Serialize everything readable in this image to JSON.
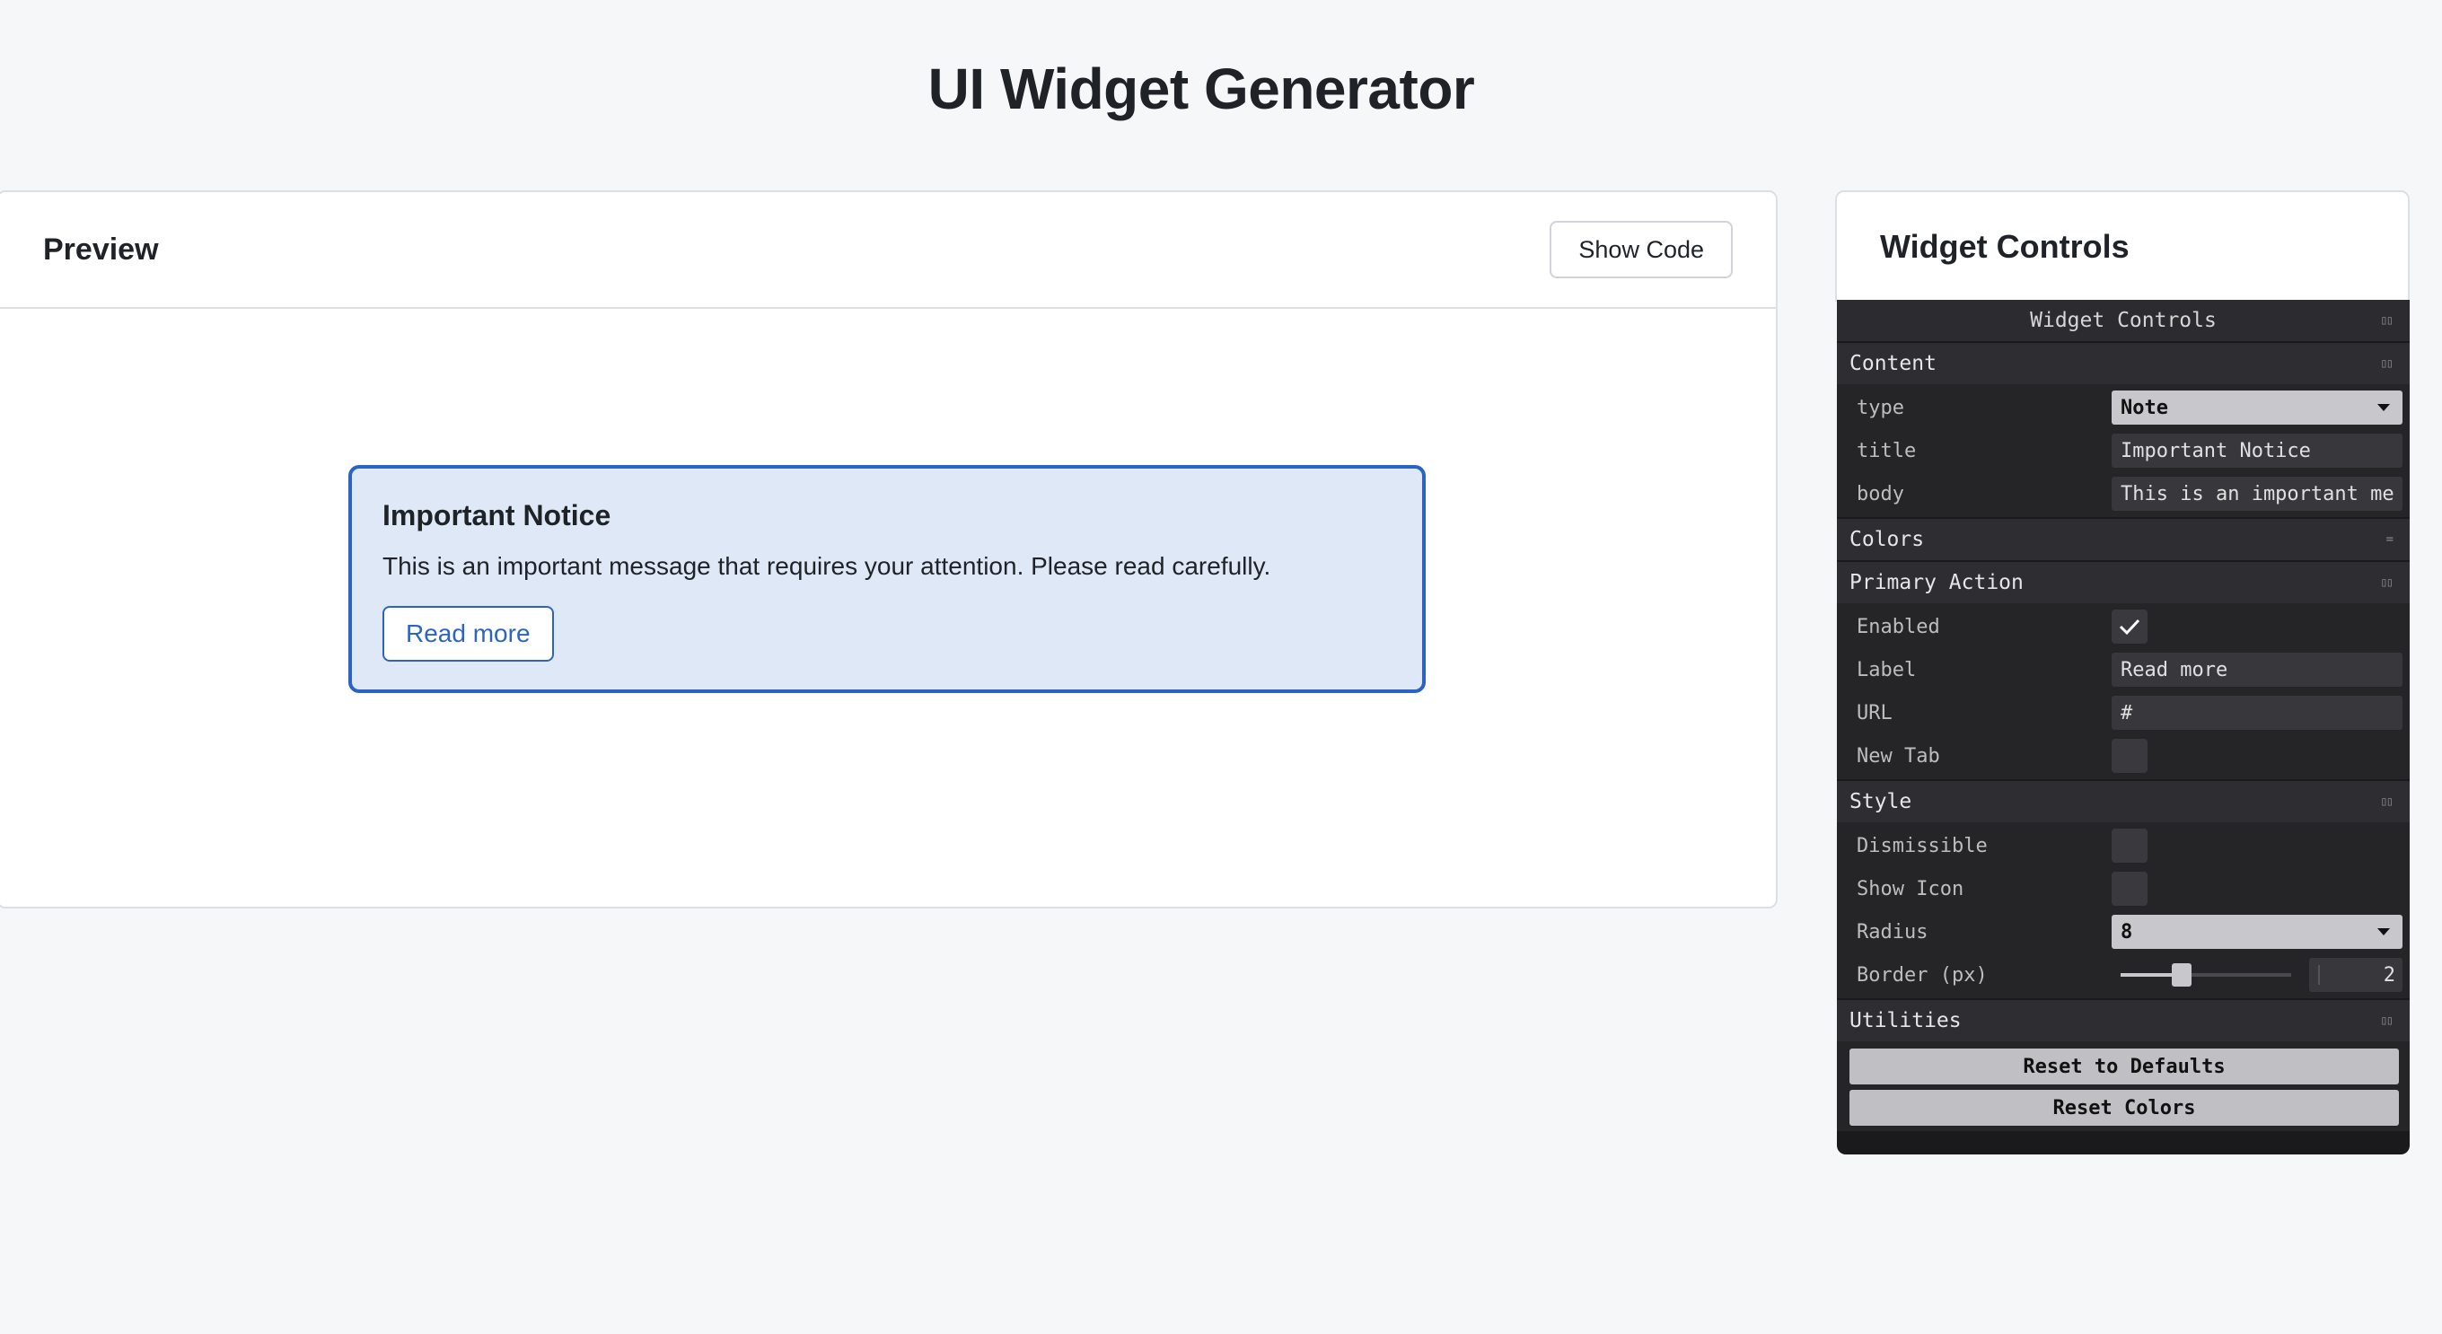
{
  "page": {
    "title": "UI Widget Generator"
  },
  "preview": {
    "heading": "Preview",
    "show_code_label": "Show Code",
    "widget": {
      "title": "Important Notice",
      "body": "This is an important message that requires your attention. Please read carefully.",
      "button_label": "Read more"
    }
  },
  "controls": {
    "card_title": "Widget Controls",
    "gui_title": "Widget Controls",
    "content": {
      "heading": "Content",
      "type_label": "type",
      "type_value": "Note",
      "title_label": "title",
      "title_value": "Important Notice",
      "body_label": "body",
      "body_value": "This is an important me"
    },
    "colors": {
      "heading": "Colors"
    },
    "primary_action": {
      "heading": "Primary Action",
      "enabled_label": "Enabled",
      "enabled": true,
      "label_label": "Label",
      "label_value": "Read more",
      "url_label": "URL",
      "url_value": "#",
      "new_tab_label": "New Tab",
      "new_tab": false
    },
    "style": {
      "heading": "Style",
      "dismissible_label": "Dismissible",
      "dismissible": false,
      "show_icon_label": "Show Icon",
      "show_icon": false,
      "radius_label": "Radius",
      "radius_value": "8",
      "border_label": "Border (px)",
      "border_value": "2",
      "border_fraction": 0.36
    },
    "utilities": {
      "heading": "Utilities",
      "reset_defaults_label": "Reset to Defaults",
      "reset_colors_label": "Reset Colors"
    }
  },
  "colors": {
    "accent": "#2c64c4",
    "notice_bg": "#dfe8f7",
    "panel_bg": "#1a1a1c"
  }
}
